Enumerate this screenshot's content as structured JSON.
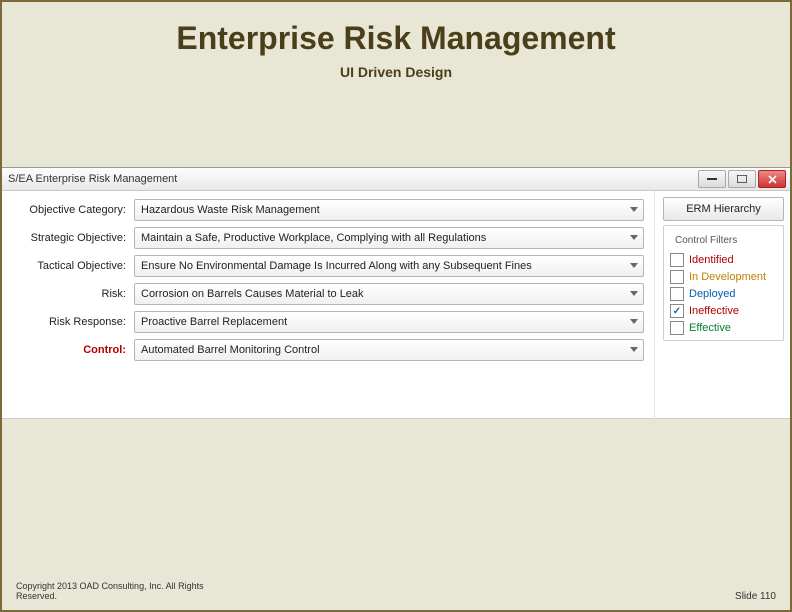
{
  "slide": {
    "title": "Enterprise Risk Management",
    "subtitle": "UI Driven Design",
    "copyright_l1": "Copyright 2013 OAD Consulting, Inc. All Rights",
    "copyright_l2": "Reserved.",
    "page": "Slide 110"
  },
  "app": {
    "window_title": "S/EA Enterprise Risk Management",
    "fields": {
      "objective_category": {
        "label": "Objective Category:",
        "value": "Hazardous Waste Risk Management"
      },
      "strategic_objective": {
        "label": "Strategic Objective:",
        "value": "Maintain a Safe, Productive Workplace, Complying with all Regulations"
      },
      "tactical_objective": {
        "label": "Tactical Objective:",
        "value": "Ensure No Environmental Damage Is Incurred Along with any Subsequent Fines"
      },
      "risk": {
        "label": "Risk:",
        "value": "Corrosion on Barrels Causes Material to Leak"
      },
      "risk_response": {
        "label": "Risk Response:",
        "value": "Proactive Barrel Replacement"
      },
      "control": {
        "label": "Control:",
        "value": "Automated Barrel Monitoring Control"
      }
    },
    "hierarchy_button": "ERM Hierarchy",
    "filters": {
      "title": "Control Filters",
      "identified": {
        "label": "Identified",
        "checked": false
      },
      "in_development": {
        "label": "In Development",
        "checked": false
      },
      "deployed": {
        "label": "Deployed",
        "checked": false
      },
      "ineffective": {
        "label": "Ineffective",
        "checked": true
      },
      "effective": {
        "label": "Effective",
        "checked": false
      }
    }
  }
}
